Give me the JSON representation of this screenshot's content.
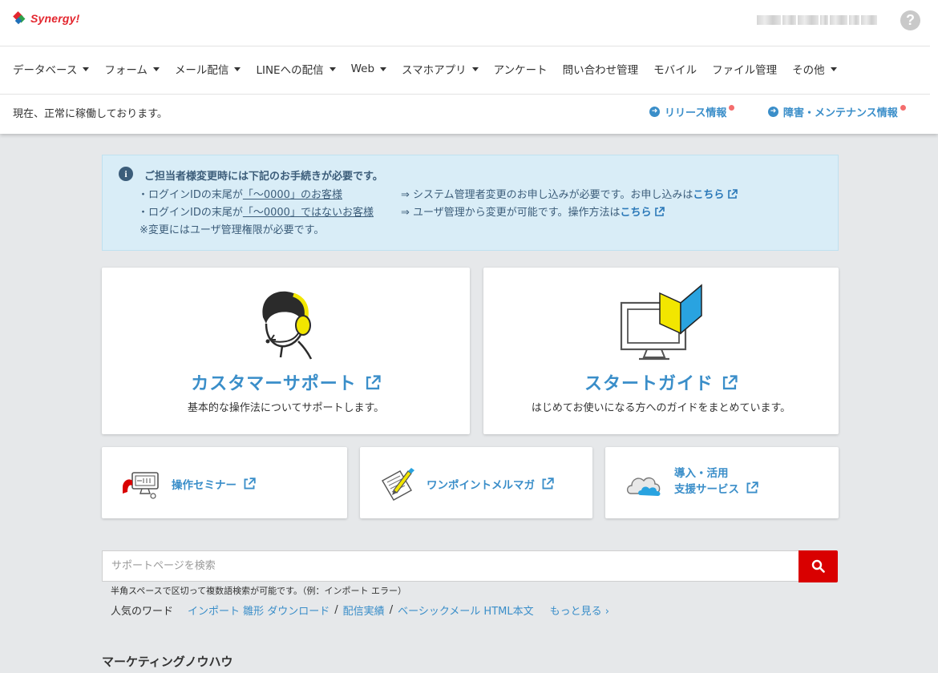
{
  "header": {
    "logo_text": "Synergy!",
    "user_name": "",
    "help_icon": "?",
    "nav": [
      {
        "label": "データベース",
        "dropdown": true
      },
      {
        "label": "フォーム",
        "dropdown": true
      },
      {
        "label": "メール配信",
        "dropdown": true
      },
      {
        "label": "LINEへの配信",
        "dropdown": true
      },
      {
        "label": "Web",
        "dropdown": true
      },
      {
        "label": "スマホアプリ",
        "dropdown": true
      },
      {
        "label": "アンケート",
        "dropdown": false
      },
      {
        "label": "問い合わせ管理",
        "dropdown": false
      },
      {
        "label": "モバイル",
        "dropdown": false
      },
      {
        "label": "ファイル管理",
        "dropdown": false
      },
      {
        "label": "その他",
        "dropdown": true
      }
    ],
    "status": "現在、正常に稼働しております。",
    "release_link": "リリース情報",
    "maintenance_link": "障害・メンテナンス情報"
  },
  "info": {
    "title": "ご担当者様変更時には下記のお手続きが必要です。",
    "line1_prefix": "・ログインIDの末尾が",
    "line1_underline": "「～0000」のお客様",
    "line1_right": "⇒ システム管理者変更のお申し込みが必要です。お申し込みは",
    "line1_link": "こちら",
    "line2_prefix": "・ログインIDの末尾が",
    "line2_underline": "「～0000」ではないお客様",
    "line2_right": "⇒ ユーザ管理から変更が可能です。操作方法は",
    "line2_link": "こちら",
    "note": "※変更にはユーザ管理権限が必要です。"
  },
  "cards": {
    "support_title": "カスタマーサポート",
    "support_sub": "基本的な操作法についてサポートします。",
    "guide_title": "スタートガイド",
    "guide_sub": "はじめてお使いになる方へのガイドをまとめています。",
    "seminar": "操作セミナー",
    "mailmag": "ワンポイントメルマガ",
    "service_line1": "導入・活用",
    "service_line2": "支援サービス"
  },
  "search": {
    "placeholder": "サポートページを検索",
    "hint": "半角スペースで区切って複数語検索が可能です。（例：インポート エラー）",
    "popular_label": "人気のワード",
    "keywords": [
      "インポート 雛形 ダウンロード",
      "配信実績",
      "ベーシックメール HTML本文"
    ],
    "more": "もっと見る ›"
  },
  "section": {
    "title": "マーケティングノウハウ"
  },
  "colors": {
    "accent": "#3a8ec9",
    "brand_red": "#e3262e",
    "search_button": "#d90000",
    "info_bg": "#d9edf7"
  }
}
